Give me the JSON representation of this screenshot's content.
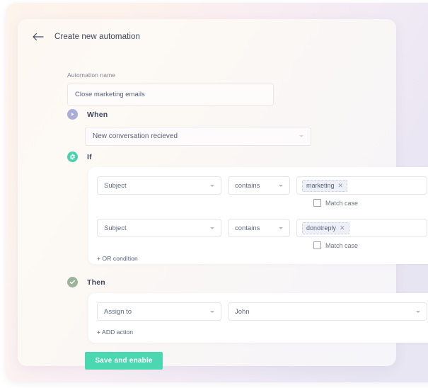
{
  "header": {
    "back_icon": "arrow-left-icon",
    "title": "Create new automation"
  },
  "automation_name": {
    "label": "Automation name",
    "value": "Close marketing emails",
    "placeholder": "Automation name"
  },
  "steps": {
    "when": {
      "label": "When",
      "icon": "play-circle-icon",
      "icon_color": "#a9aed8",
      "trigger": "New conversation recieved"
    },
    "if": {
      "label": "If",
      "icon": "gear-circle-icon",
      "icon_color": "#49d3ad",
      "conditions": [
        {
          "field": "Subject",
          "operator": "contains",
          "tags": [
            "marketing"
          ],
          "match_case_label": "Match case",
          "match_case_checked": false,
          "remove_icon": "close-icon"
        },
        {
          "field": "Subject",
          "operator": "contains",
          "tags": [
            "donotreply"
          ],
          "match_case_label": "Match case",
          "match_case_checked": false,
          "remove_icon": "close-icon"
        }
      ],
      "add_condition_label": "+ OR condition"
    },
    "then": {
      "label": "Then",
      "icon": "check-circle-icon",
      "icon_color": "#9cb49a",
      "actions": [
        {
          "action": "Assign to",
          "target": "John",
          "remove_icon": "close-icon"
        }
      ],
      "add_action_label": "+ ADD action"
    }
  },
  "footer": {
    "save_label": "Save and enable",
    "save_color": "#4bd8b0"
  }
}
